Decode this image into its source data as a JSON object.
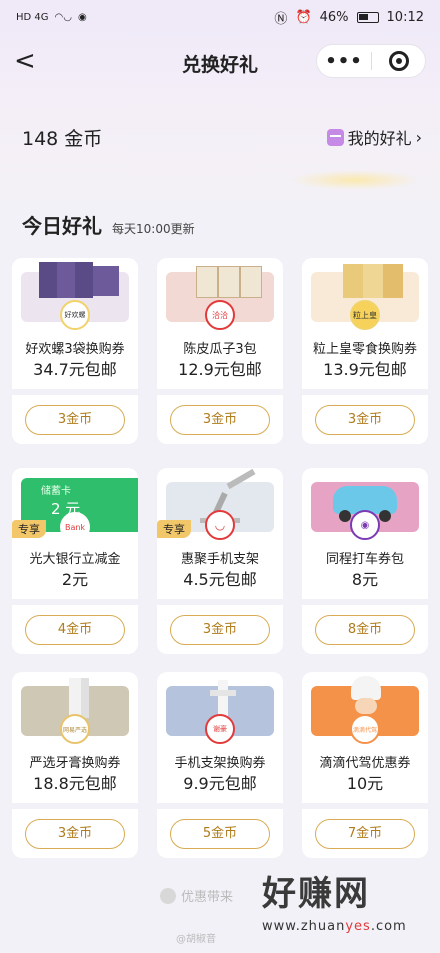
{
  "statusbar": {
    "left_icons": "HD 4G",
    "battery": "46%",
    "time": "10:12"
  },
  "navbar": {
    "back": "<",
    "title": "兑换好礼",
    "more": "•••"
  },
  "header": {
    "coins": "148 金币",
    "my_gifts": "我的好礼",
    "chevron": "›"
  },
  "section": {
    "title": "今日好礼",
    "subtitle": "每天10:00更新"
  },
  "cards": [
    {
      "name": "好欢螺3袋换购券",
      "price": "34.7元包邮",
      "button": "3金币",
      "badge": "",
      "img_color": "#ece4ef",
      "logo": "好欢螺"
    },
    {
      "name": "陈皮瓜子3包",
      "price": "12.9元包邮",
      "button": "3金币",
      "badge": "",
      "img_color": "#f2d9d3",
      "logo": "洽洽"
    },
    {
      "name": "粒上皇零食换购券",
      "price": "13.9元包邮",
      "button": "3金币",
      "badge": "",
      "img_color": "#f8ead6",
      "logo": "粒上皇"
    },
    {
      "name": "光大银行立减金",
      "price": "2元",
      "button": "4金币",
      "badge": "专享",
      "img_color": "#2fbf6c",
      "img_text1": "储蓄卡",
      "img_text2": "2 元",
      "logo": "Bank"
    },
    {
      "name": "惠聚手机支架",
      "price": "4.5元包邮",
      "button": "3金币",
      "badge": "专享",
      "img_color": "#e3e8ef",
      "logo": ""
    },
    {
      "name": "同程打车券包",
      "price": "8元",
      "button": "8金币",
      "badge": "",
      "img_color": "#e7a3c4",
      "logo": ""
    },
    {
      "name": "严选牙膏换购券",
      "price": "18.8元包邮",
      "button": "3金币",
      "badge": "",
      "img_color": "#cfc8b4",
      "logo": "网易严选"
    },
    {
      "name": "手机支架换购券",
      "price": "9.9元包邮",
      "button": "5金币",
      "badge": "",
      "img_color": "#b5c4dc",
      "logo": "谢豪"
    },
    {
      "name": "滴滴代驾优惠券",
      "price": "10元",
      "button": "7金币",
      "badge": "",
      "img_color": "#f5924a",
      "logo": "滴滴代驾"
    }
  ],
  "footer": {
    "note": "优惠带来",
    "watermark": "好赚网",
    "url_a": "www.zhuan",
    "url_b": "yes",
    "url_c": ".com",
    "weibo": "@胡椒音"
  }
}
